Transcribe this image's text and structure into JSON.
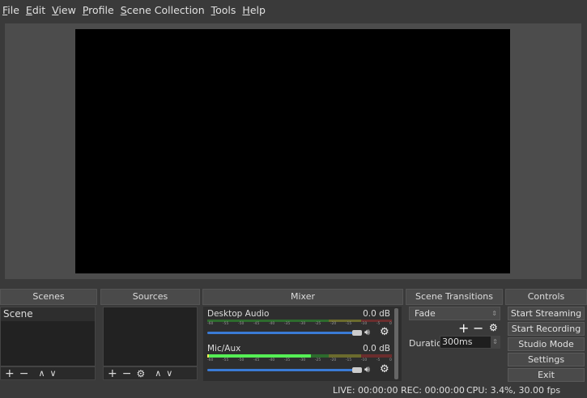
{
  "menu": [
    "File",
    "Edit",
    "View",
    "Profile",
    "Scene Collection",
    "Tools",
    "Help"
  ],
  "docks": {
    "scenes": "Scenes",
    "sources": "Sources",
    "mixer": "Mixer",
    "transitions": "Scene Transitions",
    "controls": "Controls"
  },
  "scenes": {
    "items": [
      "Scene"
    ]
  },
  "mixer": {
    "ticks": [
      "-60",
      "-55",
      "-50",
      "-45",
      "-40",
      "-35",
      "-30",
      "-25",
      "-20",
      "-15",
      "-10",
      "-5",
      "0"
    ],
    "channels": [
      {
        "name": "Desktop Audio",
        "db": "0.0 dB",
        "volume": 1.0
      },
      {
        "name": "Mic/Aux",
        "db": "0.0 dB",
        "volume": 1.0
      }
    ]
  },
  "transitions": {
    "selected": "Fade",
    "duration_label": "Duration",
    "duration": "300ms"
  },
  "controls": [
    "Start Streaming",
    "Start Recording",
    "Studio Mode",
    "Settings",
    "Exit"
  ],
  "status": {
    "live": "LIVE: 00:00:00",
    "rec": "REC: 00:00:00",
    "cpu": "CPU: 3.4%, 30.00 fps"
  }
}
